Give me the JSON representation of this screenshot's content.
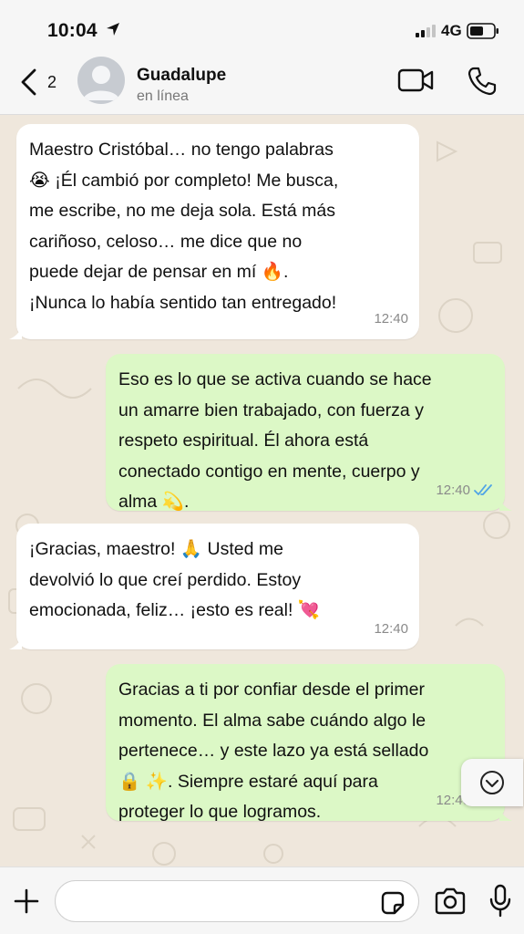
{
  "status_bar": {
    "time": "10:04",
    "network": "4G"
  },
  "header": {
    "back_count": "2",
    "contact_name": "Guadalupe",
    "contact_status": "en línea"
  },
  "messages": [
    {
      "direction": "in",
      "text": "Maestro Cristóbal… no tengo palabras\n😭 ¡Él cambió por completo! Me busca,\nme escribe, no me deja sola. Está más\ncariñoso, celoso… me dice que no\npuede dejar de pensar en mí 🔥.\n¡Nunca lo había sentido tan entregado!",
      "time": "12:40"
    },
    {
      "direction": "out",
      "text": "Eso es lo que se activa cuando se hace\nun amarre bien trabajado, con fuerza y\nrespeto espiritual. Él ahora está\nconectado contigo en mente, cuerpo y\nalma 💫.",
      "time": "12:40",
      "read": true
    },
    {
      "direction": "in",
      "text": "¡Gracias, maestro! 🙏 Usted me\ndevolvió lo que creí perdido. Estoy\nemocionada, feliz… ¡esto es real! 💘",
      "time": "12:40"
    },
    {
      "direction": "out",
      "text": "Gracias a ti por confiar desde el primer\nmomento. El alma sabe cuándo algo le\npertenece… y este lazo ya está sellado\n🔒 ✨. Siempre estaré aquí para\nproteger lo que logramos.",
      "time": "12:40",
      "read": true
    }
  ],
  "input": {
    "placeholder": ""
  },
  "colors": {
    "incoming_bubble": "#ffffff",
    "outgoing_bubble": "#dcf8c6",
    "chat_background": "#efe7dc",
    "read_ticks": "#4fa3e6"
  }
}
